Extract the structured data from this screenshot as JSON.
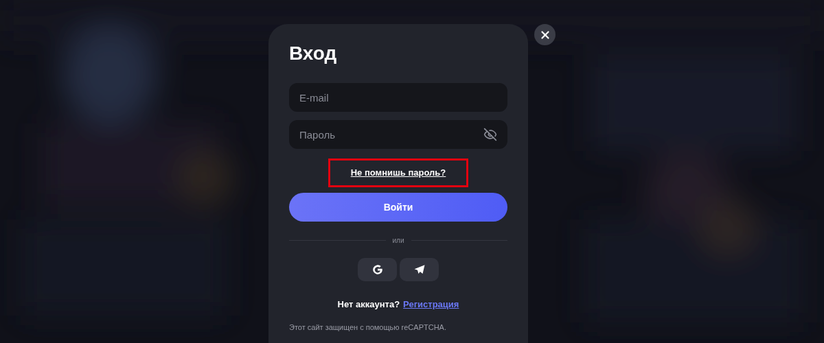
{
  "dialog": {
    "title": "Вход",
    "fields": [
      {
        "kind": "text",
        "placeholder": "E-mail"
      },
      {
        "kind": "password",
        "placeholder": "Пароль"
      }
    ],
    "forgot_link": {
      "label": "Не помнишь пароль?",
      "highlighted": true
    },
    "submit": "Войти",
    "divider": "или",
    "social": [
      {
        "kind": "google"
      },
      {
        "kind": "telegram"
      }
    ],
    "signup": {
      "prompt": "Нет аккаунта?",
      "link": "Регистрация"
    },
    "captcha_note": "Этот сайт защищен с помощью reCAPTCHA."
  }
}
